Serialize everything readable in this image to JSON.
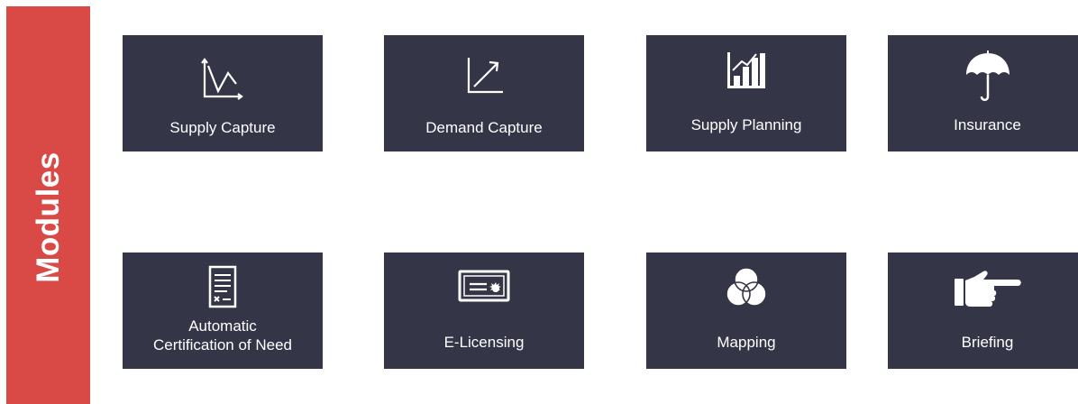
{
  "sidebar": {
    "title": "Modules"
  },
  "modules": [
    {
      "label": "Supply Capture",
      "icon": "chart-axes-decline-icon"
    },
    {
      "label": "Demand Capture",
      "icon": "chart-axes-growth-icon"
    },
    {
      "label": "Supply Planning",
      "icon": "bar-chart-icon"
    },
    {
      "label": "Insurance",
      "icon": "umbrella-icon"
    },
    {
      "label_line1": "Automatic",
      "label_line2": "Certification of Need",
      "icon": "document-certificate-icon"
    },
    {
      "label": "E-Licensing",
      "icon": "license-card-icon"
    },
    {
      "label": "Mapping",
      "icon": "venn-diagram-icon"
    },
    {
      "label": "Briefing",
      "icon": "pointing-hand-icon"
    }
  ],
  "colors": {
    "sidebar": "#d94a47",
    "tile": "#353548",
    "text": "#ffffff"
  }
}
